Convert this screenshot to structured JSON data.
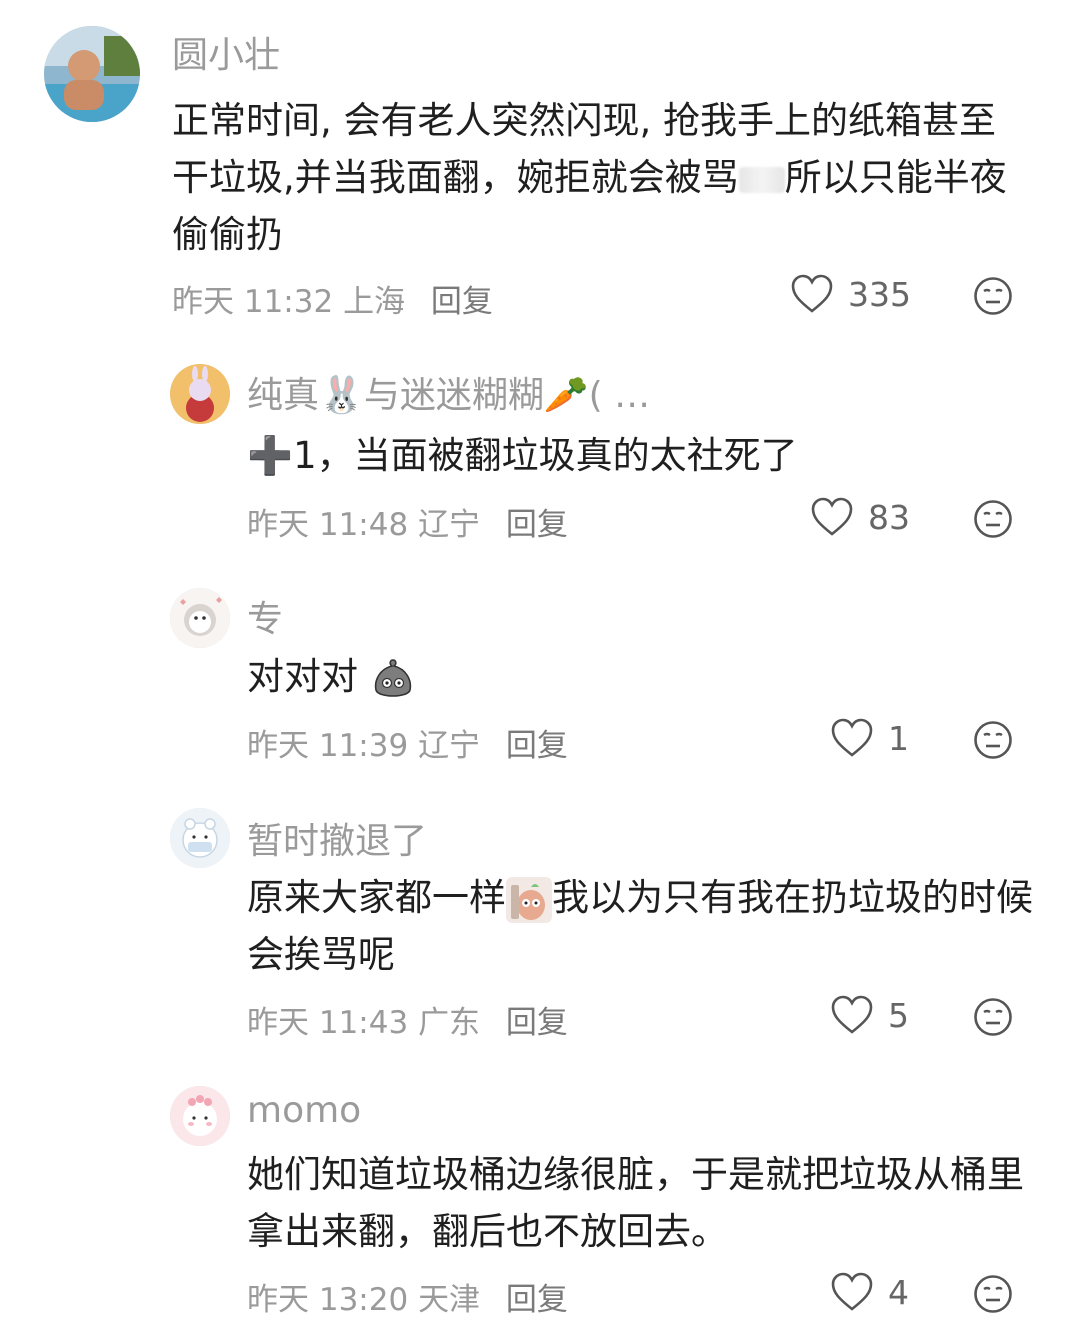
{
  "comments": [
    {
      "name": "圆小壮",
      "text_parts": [
        "正常时间, 会有老人突然闪现, 抢我手上的纸箱甚至干垃圾,并当我面翻，婉拒就会被骂",
        "所以只能半夜偷偷扔"
      ],
      "time": "昨天 11:32",
      "location": "上海",
      "reply": "回复",
      "likes": "335"
    },
    {
      "name": "纯真🐰与迷迷糊糊🥕( …",
      "text": "➕1，当面被翻垃圾真的太社死了",
      "time": "昨天 11:48",
      "location": "辽宁",
      "reply": "回复",
      "likes": "83"
    },
    {
      "name": "专",
      "text": "对对对",
      "time": "昨天 11:39",
      "location": "辽宁",
      "reply": "回复",
      "likes": "1"
    },
    {
      "name": "暂时撤退了",
      "text_parts": [
        "原来大家都一样",
        "我以为只有我在扔垃圾的时候会挨骂呢"
      ],
      "time": "昨天 11:43",
      "location": "广东",
      "reply": "回复",
      "likes": "5"
    },
    {
      "name": "momo",
      "text": "她们知道垃圾桶边缘很脏，于是就把垃圾从桶里拿出来翻，翻后也不放回去。",
      "time": "昨天 13:20",
      "location": "天津",
      "reply": "回复",
      "likes": "4"
    }
  ],
  "icons": {
    "like": "heart-outline-icon",
    "dislike": "meh-face-icon",
    "emoji_1": "garbage-bag-emoji",
    "emoji_2": "shy-character-emoji"
  },
  "colors": {
    "name": "#9a9a9a",
    "text": "#1f1f1f",
    "meta": "#9a9a9a",
    "icon": "#555555"
  }
}
